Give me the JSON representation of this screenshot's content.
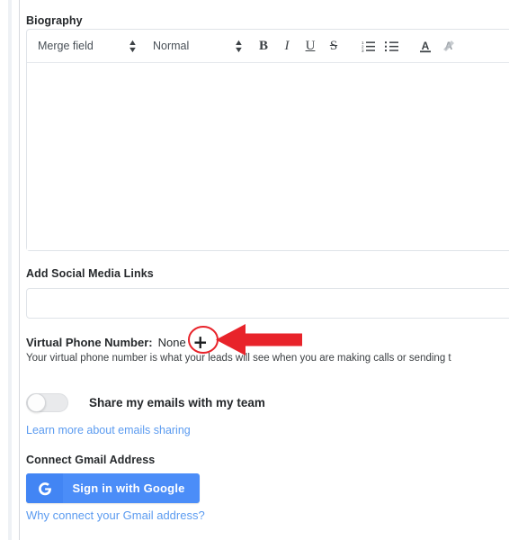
{
  "panel": {
    "biography": {
      "label": "Biography",
      "editor": {
        "merge_field_select": {
          "value": "Merge field",
          "name": "merge-field-select"
        },
        "format_select": {
          "value": "Normal",
          "name": "format-select"
        },
        "buttons": [
          {
            "name": "bold-icon",
            "glyph": "B"
          },
          {
            "name": "italic-icon",
            "glyph": "I"
          },
          {
            "name": "underline-icon",
            "glyph": "U"
          },
          {
            "name": "strikethrough-icon",
            "glyph": "S"
          }
        ],
        "list_buttons": [
          {
            "name": "ordered-list-icon"
          },
          {
            "name": "unordered-list-icon"
          }
        ],
        "color_buttons": [
          {
            "name": "font-color-icon",
            "glyph": "A"
          },
          {
            "name": "highlight-color-icon",
            "glyph": "A"
          }
        ],
        "content": ""
      }
    },
    "social": {
      "label": "Add Social Media Links",
      "input_value": "",
      "input_placeholder": ""
    },
    "virtual_phone": {
      "label": "Virtual Phone Number:",
      "value": "None",
      "add_icon": "+",
      "help_text": "Your virtual phone number is what your leads will see when you are making calls or sending t"
    },
    "share_emails": {
      "toggle_state": "off",
      "label": "Share my emails with my team",
      "link": "Learn more about emails sharing"
    },
    "gmail": {
      "label": "Connect Gmail Address",
      "button_text": "Sign in with Google",
      "button_icon": "google-g-icon",
      "link": "Why connect your Gmail address?"
    }
  },
  "annotation": {
    "highlight_target": "virtual-phone-add-button",
    "circle_color": "#e8232a",
    "arrow_color": "#e8232a",
    "arrow_direction": "left"
  },
  "colors": {
    "accent_blue": "#4b8df8",
    "google_blue": "#4285f4",
    "link_blue": "#5b9bf0",
    "annotation_red": "#e8232a",
    "border_gray": "#dfe3e8",
    "text_dark": "#25282b"
  }
}
